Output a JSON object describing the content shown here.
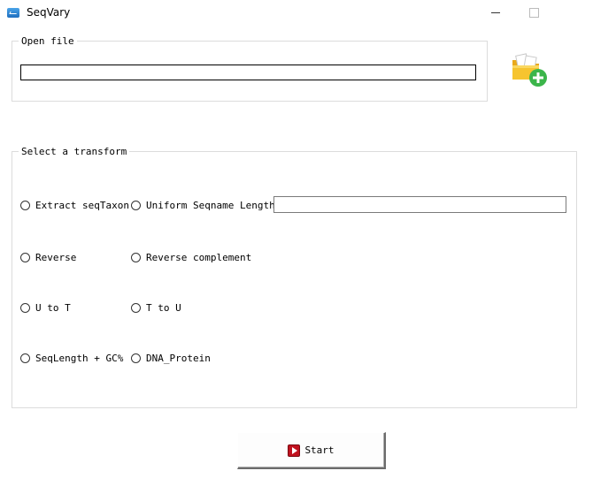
{
  "window": {
    "title": "SeqVary"
  },
  "open_file": {
    "legend": "Open file",
    "path_value": "",
    "open_button_icon": "folder-add-icon"
  },
  "transform": {
    "legend": "Select a transform",
    "options": [
      {
        "label": "Extract seqTaxon",
        "selected": false
      },
      {
        "label": "Uniform Seqname Length",
        "selected": false
      },
      {
        "label": "Reverse",
        "selected": false
      },
      {
        "label": "Reverse complement",
        "selected": false
      },
      {
        "label": "U to T",
        "selected": false
      },
      {
        "label": "T to U",
        "selected": false
      },
      {
        "label": "SeqLength + GC%",
        "selected": false
      },
      {
        "label": "DNA_Protein",
        "selected": false
      }
    ],
    "length_value": ""
  },
  "start": {
    "label": "Start",
    "icon": "play-icon",
    "icon_color": "#c1121f"
  }
}
